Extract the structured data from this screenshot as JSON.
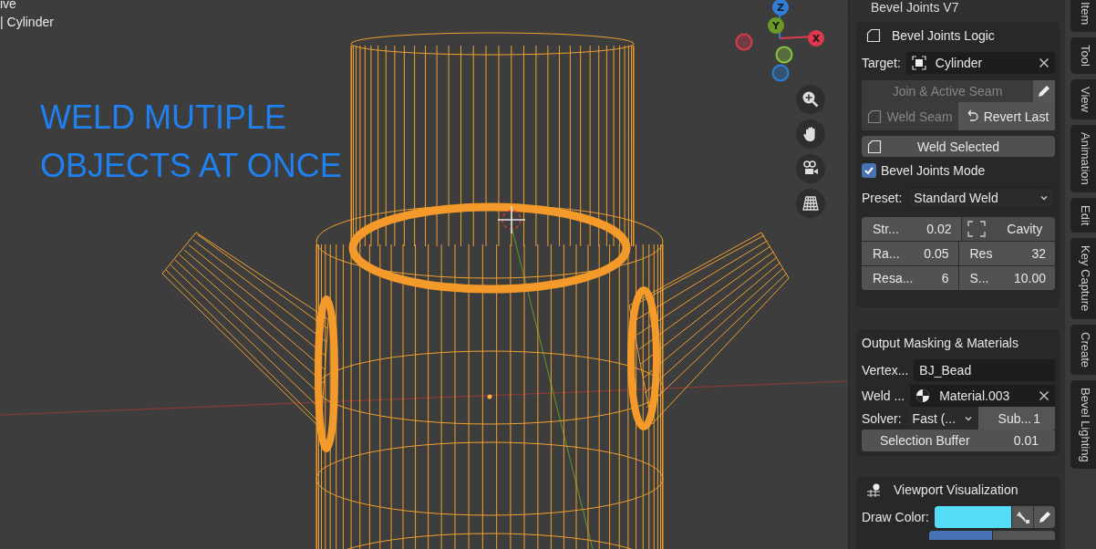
{
  "viewport": {
    "header_lines": [
      "ive",
      "| Cylinder"
    ],
    "overlay_lines": [
      "WELD MUTIPLE",
      "OBJECTS AT ONCE"
    ],
    "gizmo_axes": [
      {
        "label": "Z",
        "kind": "positive",
        "color": "#2f7fd8"
      },
      {
        "label": "Y",
        "kind": "positive",
        "color": "#6c9a24"
      },
      {
        "label": "X",
        "kind": "positive",
        "color": "#e0384f"
      },
      {
        "kind": "negative",
        "color": "#e0384f"
      },
      {
        "kind": "negative",
        "color": "#8cc63f"
      },
      {
        "kind": "negative",
        "color": "#2f7fd8"
      }
    ]
  },
  "panel": {
    "title": "Bevel Joints V7",
    "logic": {
      "title": "Bevel Joints Logic",
      "target_label": "Target:",
      "target_value": "Cylinder",
      "join_button": {
        "label": "Join & Active Seam",
        "disabled": true
      },
      "weld_seam": {
        "label": "Weld Seam",
        "disabled": true
      },
      "revert": {
        "label": "Revert Last",
        "disabled": false
      },
      "weld_selected": {
        "label": "Weld Selected",
        "disabled": false
      },
      "mode": {
        "label": "Bevel Joints Mode",
        "checked": true
      },
      "preset_label": "Preset:",
      "preset_value": "Standard Weld",
      "params": [
        [
          {
            "kind": "number",
            "label": "Str...",
            "value": "0.02"
          },
          {
            "kind": "toggle",
            "label": "Cavity",
            "checked": false
          }
        ],
        [
          {
            "kind": "number",
            "label": "Ra...",
            "value": "0.05"
          },
          {
            "kind": "number",
            "label": "Res",
            "value": "32"
          }
        ],
        [
          {
            "kind": "number",
            "label": "Resa...",
            "value": "6"
          },
          {
            "kind": "number",
            "label": "S...",
            "value": "10.00"
          }
        ]
      ]
    },
    "output": {
      "title": "Output Masking & Materials",
      "vertex_label": "Vertex...",
      "vertex_value": "BJ_Bead",
      "weld_label": "Weld ...",
      "weld_value": "Material.003",
      "solver_label": "Solver:",
      "solver_value": "Fast (...",
      "sub_label": "Sub...",
      "sub_value": "1",
      "buffer_label": "Selection Buffer",
      "buffer_value": "0.01"
    },
    "visualization": {
      "title": "Viewport Visualization",
      "draw_color": {
        "label": "Draw Color:",
        "color": "#55dcf7"
      }
    }
  },
  "side_tabs": [
    "Item",
    "Tool",
    "View",
    "Animation",
    "Edit",
    "Key Capture",
    "Create",
    "Bevel Lighting"
  ]
}
